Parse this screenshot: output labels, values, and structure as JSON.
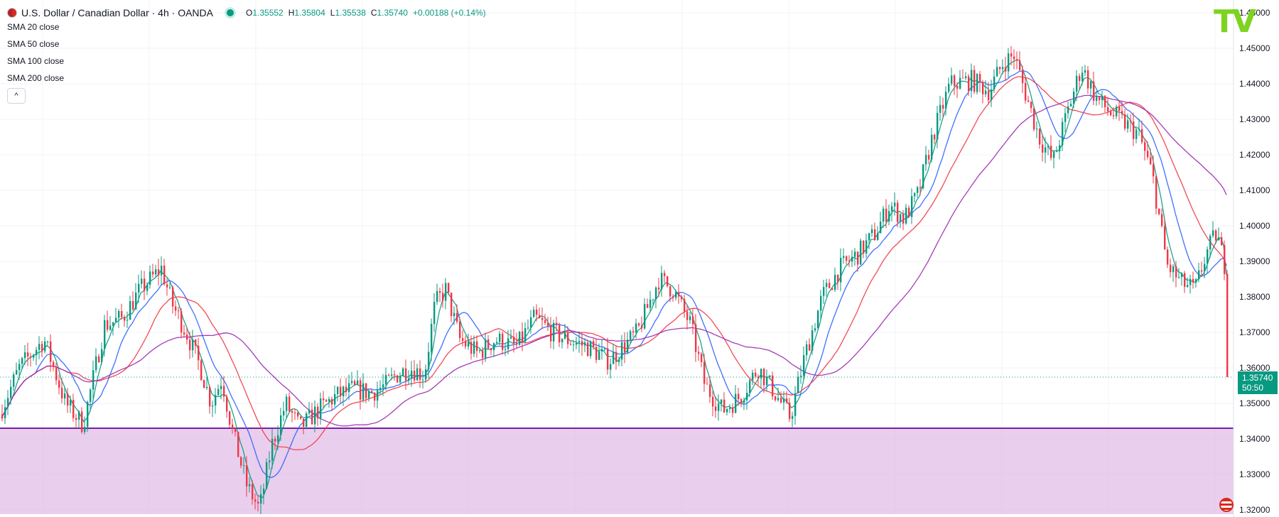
{
  "header": {
    "title": "U.S. Dollar / Canadian Dollar · 4h · OANDA",
    "ohlc": [
      {
        "k": "O",
        "v": "1.35552"
      },
      {
        "k": "H",
        "v": "1.35804"
      },
      {
        "k": "L",
        "v": "1.35538"
      },
      {
        "k": "C",
        "v": "1.35740"
      },
      {
        "k": "",
        "v": "+0.00188 (+0.14%)"
      }
    ],
    "indicators": [
      "SMA 20 close",
      "SMA 50 close",
      "SMA 100 close",
      "SMA 200 close"
    ],
    "collapse_label": "^"
  },
  "logo": "TV",
  "last_price": {
    "value": "1.35740",
    "countdown": "50:50",
    "color": "#089981"
  },
  "colors": {
    "up": "#089981",
    "down": "#f23645",
    "sma20": "#089981",
    "sma50": "#2962ff",
    "sma100": "#f23645",
    "sma200": "#9c27b0",
    "zone": "#e1bee7",
    "zone_line": "#7b1fa2"
  },
  "chart_data": {
    "type": "candlestick",
    "symbol": "USDCAD",
    "timeframe": "4h",
    "ylim": [
      1.316,
      1.464
    ],
    "y_ticks": [
      "1.46000",
      "1.45000",
      "1.44000",
      "1.43000",
      "1.42000",
      "1.41000",
      "1.40000",
      "1.39000",
      "1.38000",
      "1.37000",
      "1.36000",
      "1.35000",
      "1.34000",
      "1.33000",
      "1.32000"
    ],
    "support_level": 1.343,
    "last_close": 1.3574,
    "path_anchors": [
      [
        0,
        1.346
      ],
      [
        30,
        1.36
      ],
      [
        65,
        1.368
      ],
      [
        95,
        1.35
      ],
      [
        120,
        1.344
      ],
      [
        150,
        1.372
      ],
      [
        175,
        1.374
      ],
      [
        200,
        1.382
      ],
      [
        230,
        1.388
      ],
      [
        245,
        1.378
      ],
      [
        265,
        1.37
      ],
      [
        285,
        1.36
      ],
      [
        300,
        1.35
      ],
      [
        315,
        1.357
      ],
      [
        330,
        1.342
      ],
      [
        350,
        1.327
      ],
      [
        368,
        1.32
      ],
      [
        385,
        1.338
      ],
      [
        405,
        1.35
      ],
      [
        425,
        1.343
      ],
      [
        450,
        1.348
      ],
      [
        475,
        1.352
      ],
      [
        500,
        1.354
      ],
      [
        525,
        1.353
      ],
      [
        545,
        1.355
      ],
      [
        560,
        1.358
      ],
      [
        580,
        1.36
      ],
      [
        600,
        1.358
      ],
      [
        615,
        1.378
      ],
      [
        630,
        1.382
      ],
      [
        650,
        1.368
      ],
      [
        675,
        1.364
      ],
      [
        700,
        1.368
      ],
      [
        730,
        1.366
      ],
      [
        755,
        1.374
      ],
      [
        780,
        1.37
      ],
      [
        800,
        1.368
      ],
      [
        830,
        1.366
      ],
      [
        860,
        1.362
      ],
      [
        900,
        1.37
      ],
      [
        930,
        1.385
      ],
      [
        950,
        1.382
      ],
      [
        975,
        1.372
      ],
      [
        995,
        1.355
      ],
      [
        1020,
        1.348
      ],
      [
        1045,
        1.352
      ],
      [
        1070,
        1.36
      ],
      [
        1090,
        1.354
      ],
      [
        1115,
        1.346
      ],
      [
        1135,
        1.363
      ],
      [
        1160,
        1.38
      ],
      [
        1185,
        1.388
      ],
      [
        1210,
        1.392
      ],
      [
        1235,
        1.398
      ],
      [
        1255,
        1.406
      ],
      [
        1275,
        1.402
      ],
      [
        1295,
        1.409
      ],
      [
        1315,
        1.425
      ],
      [
        1340,
        1.44
      ],
      [
        1370,
        1.441
      ],
      [
        1395,
        1.438
      ],
      [
        1415,
        1.446
      ],
      [
        1430,
        1.448
      ],
      [
        1445,
        1.438
      ],
      [
        1465,
        1.425
      ],
      [
        1485,
        1.418
      ],
      [
        1505,
        1.432
      ],
      [
        1525,
        1.445
      ],
      [
        1545,
        1.436
      ],
      [
        1565,
        1.432
      ],
      [
        1585,
        1.429
      ],
      [
        1605,
        1.426
      ],
      [
        1625,
        1.414
      ],
      [
        1645,
        1.389
      ],
      [
        1665,
        1.384
      ],
      [
        1685,
        1.382
      ],
      [
        1700,
        1.392
      ],
      [
        1715,
        1.398
      ],
      [
        1730,
        1.386
      ],
      [
        1745,
        1.383
      ],
      [
        1760,
        1.372
      ],
      [
        1780,
        1.37
      ],
      [
        1796,
        1.3574
      ]
    ]
  }
}
